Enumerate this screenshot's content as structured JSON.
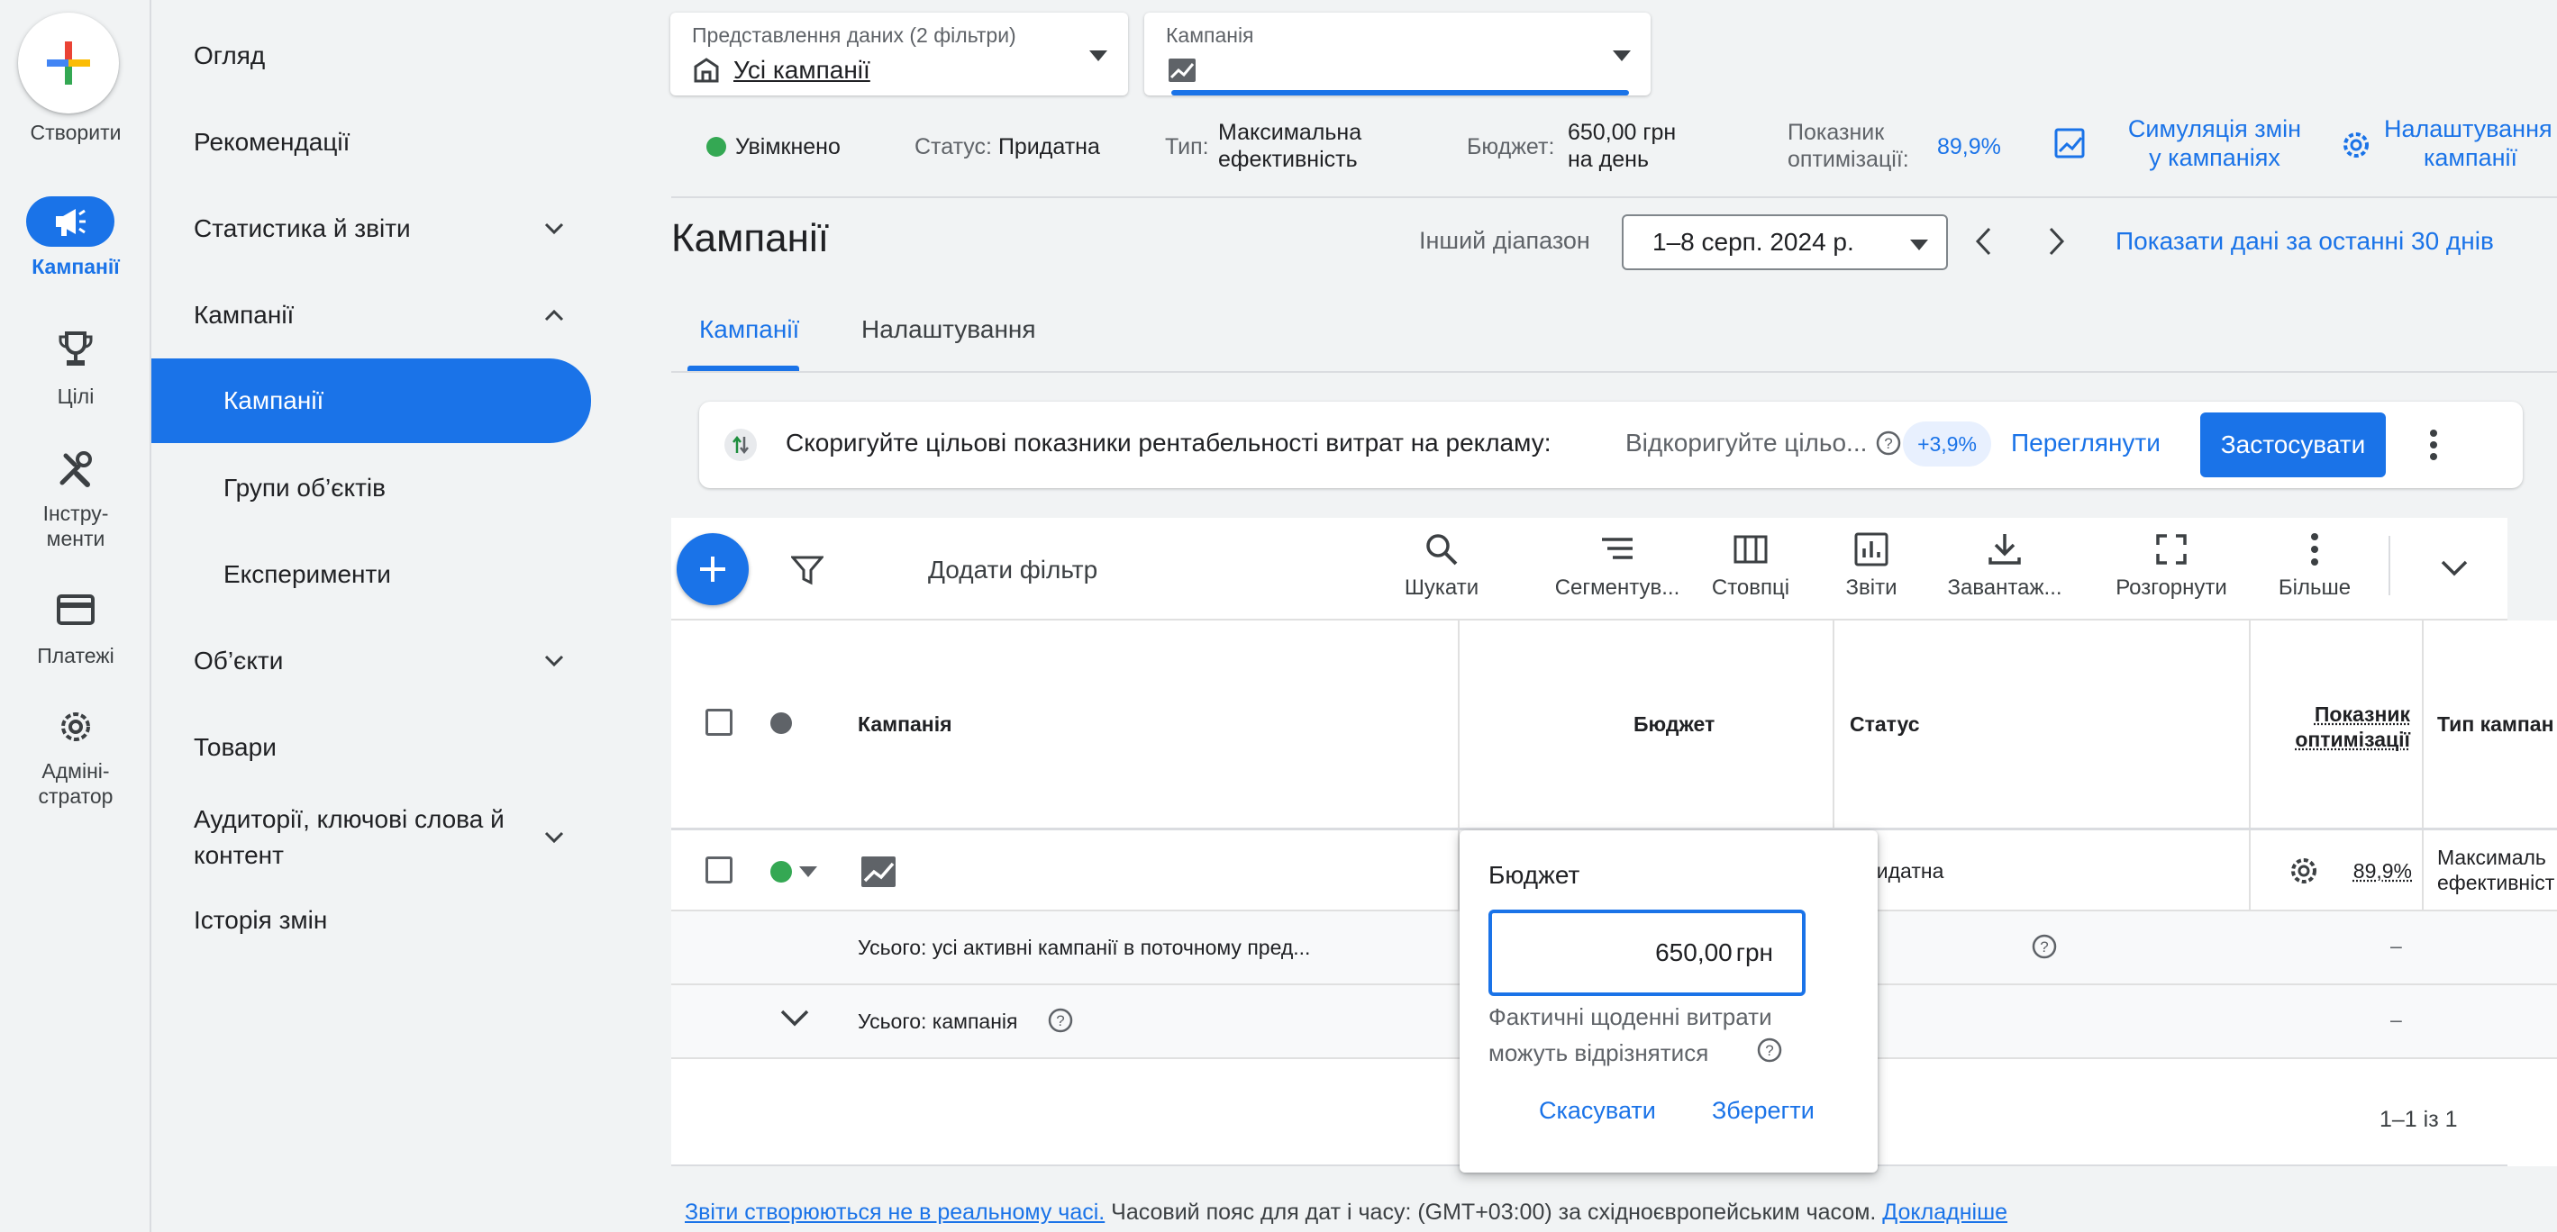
{
  "rail": {
    "create_label": "Створити",
    "items": [
      {
        "label": "Кампанії",
        "icon": "campaign-megaphone-icon",
        "active": true
      },
      {
        "label": "Цілі",
        "icon": "trophy-icon"
      },
      {
        "label": "Інстру-\nменти",
        "icon": "tools-icon"
      },
      {
        "label": "Платежі",
        "icon": "credit-card-icon"
      },
      {
        "label": "Адміні-\nстратор",
        "icon": "gear-icon"
      }
    ]
  },
  "nav": {
    "items": [
      {
        "label": "Огляд"
      },
      {
        "label": "Рекомендації"
      },
      {
        "label": "Статистика й звіти",
        "chevron": "down"
      },
      {
        "label": "Кампанії",
        "chevron": "up"
      },
      {
        "label": "Кампанії",
        "sub": true,
        "active": true
      },
      {
        "label": "Групи об’єктів",
        "sub": true
      },
      {
        "label": "Експерименти",
        "sub": true
      },
      {
        "label": "Об’єкти",
        "chevron": "down"
      },
      {
        "label": "Товари"
      },
      {
        "label": "Аудиторії, ключові слова й\nконтент",
        "chevron": "down"
      },
      {
        "label": "Історія змін"
      }
    ]
  },
  "filters": {
    "view_label": "Представлення даних (2 фільтри)",
    "view_value": "Усі кампанії",
    "campaign_label": "Кампанія"
  },
  "status_bar": {
    "enabled": "Увімкнено",
    "status_label": "Статус:",
    "status_value": "Придатна",
    "type_label": "Тип:",
    "type_value_1": "Максимальна",
    "type_value_2": "ефективність",
    "budget_label": "Бюджет:",
    "budget_value_1": "650,00 грн",
    "budget_value_2": "на день",
    "opt_label_1": "Показник",
    "opt_label_2": "оптимізації:",
    "opt_value": "89,9%",
    "simulate_1": "Симуляція змін",
    "simulate_2": "у кампаніях",
    "settings_1": "Налаштування",
    "settings_2": "кампанії"
  },
  "header": {
    "title": "Кампанії",
    "other_range": "Інший діапазон",
    "date_range": "1–8 серп. 2024 р.",
    "last30": "Показати дані за останні 30 днів"
  },
  "tabs": [
    {
      "label": "Кампанії",
      "active": true
    },
    {
      "label": "Налаштування"
    }
  ],
  "recommendation": {
    "title": "Скоригуйте цільові показники рентабельності витрат на рекламу:",
    "desc": "Відкоригуйте цільо...",
    "uplift": "+3,9%",
    "view": "Переглянути",
    "apply": "Застосувати"
  },
  "toolbar": {
    "add_filter": "Додати фільтр",
    "tools": [
      {
        "label": "Шукати",
        "icon": "search-icon"
      },
      {
        "label": "Сегментув...",
        "icon": "segment-icon"
      },
      {
        "label": "Стовпці",
        "icon": "columns-icon"
      },
      {
        "label": "Звіти",
        "icon": "reports-icon"
      },
      {
        "label": "Завантаж...",
        "icon": "download-icon"
      },
      {
        "label": "Розгорнути",
        "icon": "expand-icon"
      },
      {
        "label": "Більше",
        "icon": "more-vert-icon"
      }
    ]
  },
  "table": {
    "columns": [
      "Кампанія",
      "Бюджет",
      "Статус",
      "Показник\nоптимізації",
      "Тип кампан"
    ],
    "row": {
      "status": "ридатна",
      "opt": "89,9%",
      "type_1": "Максималь",
      "type_2": "ефективніст"
    },
    "total_all": "Усього: усі активні кампанії в поточному пред...",
    "total_campaign": "Усього: кампанія",
    "dash": "–",
    "pagination": "1–1 із 1"
  },
  "budget_popup": {
    "title": "Бюджет",
    "value": "650,00",
    "currency": "грн",
    "hint_1": "Фактичні щоденні витрати",
    "hint_2": "можуть відрізнятися",
    "cancel": "Скасувати",
    "save": "Зберегти"
  },
  "footer": {
    "link": "Звіти створюються не в реальному часі.",
    "text": " Часовий пояс для дат і часу: (GMT+03:00) за східноєвропейським часом. ",
    "more": "Докладніше"
  },
  "colors": {
    "accent": "#1a73e8",
    "enabled_green": "#34a853"
  }
}
